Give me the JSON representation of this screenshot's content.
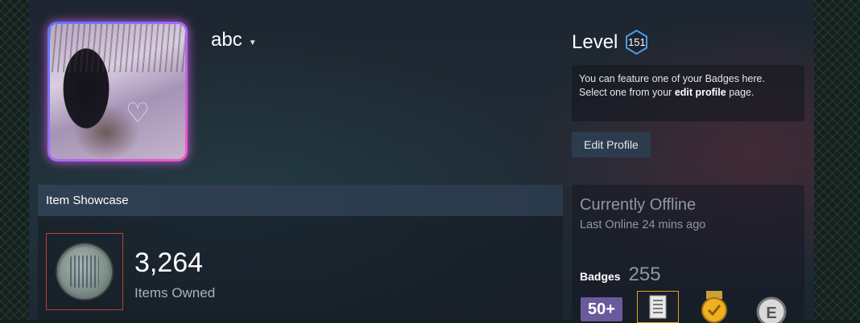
{
  "profile": {
    "persona_name": "abc",
    "level_label": "Level",
    "level_value": "151",
    "feature_text_1": "You can feature one of your Badges here.",
    "feature_text_2a": "Select one from your ",
    "feature_text_2b": "edit profile",
    "feature_text_2c": " page.",
    "edit_button": "Edit Profile"
  },
  "showcase": {
    "header": "Item Showcase",
    "count": "3,264",
    "count_label": "Items Owned"
  },
  "status": {
    "title": "Currently Offline",
    "last_online": "Last Online 24 mins ago",
    "badges_label": "Badges",
    "badges_count": "255",
    "badge_50_text": "50+"
  },
  "colors": {
    "accent_blue": "#5a7bff",
    "accent_pink": "#ff4fc0",
    "level_ring": "#4f9be8",
    "slot_border": "#c0402f",
    "badge_gold": "#e0a520"
  },
  "icons": {
    "caret": "caret-down-icon",
    "level_hex": "hexagon-level-icon",
    "badge_book": "book-badge-icon",
    "badge_medal": "medal-badge-icon",
    "badge_e": "letter-e-badge-icon"
  }
}
